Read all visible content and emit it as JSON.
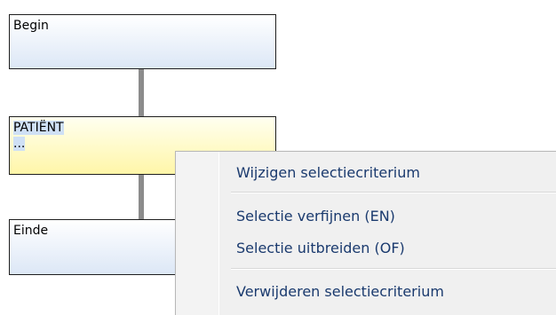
{
  "flow": {
    "nodes": [
      {
        "label": "Begin",
        "sublabel": ""
      },
      {
        "label": "PATIËNT",
        "sublabel": "..."
      },
      {
        "label": "Einde",
        "sublabel": ""
      }
    ]
  },
  "context_menu": {
    "items": [
      "Wijzigen selectiecriterium",
      "Selectie verfijnen (EN)",
      "Selectie uitbreiden (OF)",
      "Verwijderen selectiecriterium"
    ]
  }
}
